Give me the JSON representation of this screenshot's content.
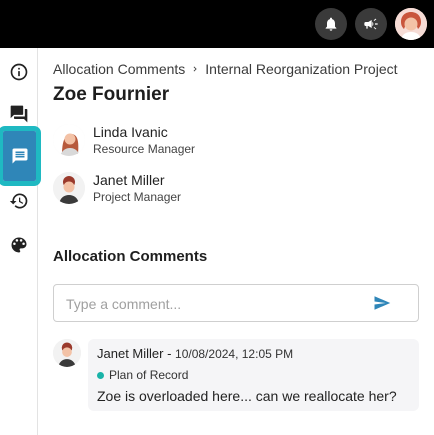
{
  "colors": {
    "topbar": "#000000",
    "rail_active": "#2f86b8",
    "rail_active_ring": "#1fb9c2",
    "send_icon": "#2f86b8",
    "tag_dot": "#19b3a8"
  },
  "topbar": {
    "icons": [
      "bell-icon",
      "megaphone-icon"
    ],
    "avatar": "user-avatar"
  },
  "rail": {
    "items": [
      {
        "icon": "info-icon",
        "active": false
      },
      {
        "icon": "forum-icon",
        "active": false
      },
      {
        "icon": "comment-icon",
        "active": true
      },
      {
        "icon": "history-icon",
        "active": false
      },
      {
        "icon": "palette-icon",
        "active": false
      }
    ]
  },
  "breadcrumb": {
    "parent": "Allocation Comments",
    "current": "Internal Reorganization Project"
  },
  "page_title": "Zoe Fournier",
  "people": [
    {
      "name": "Linda Ivanic",
      "role": "Resource Manager"
    },
    {
      "name": "Janet Miller",
      "role": "Project Manager"
    }
  ],
  "section_title": "Allocation Comments",
  "comment_input": {
    "placeholder": "Type a comment...",
    "value": ""
  },
  "comments": [
    {
      "author": "Janet Miller",
      "separator": " - ",
      "date": "10/08/2024, 12:05 PM",
      "tag": "Plan of Record",
      "text": "Zoe is overloaded here... can we reallocate her?"
    }
  ]
}
